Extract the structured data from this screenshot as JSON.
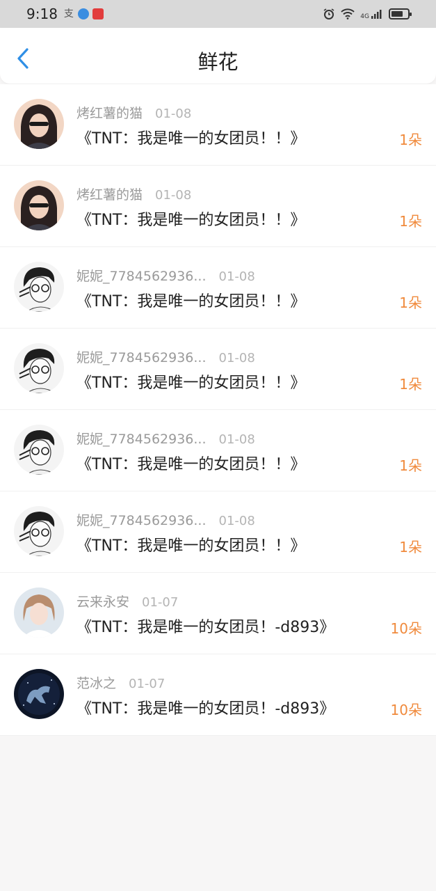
{
  "status": {
    "time": "9:18",
    "app1": "支",
    "network": "4G"
  },
  "header": {
    "title": "鲜花"
  },
  "items": [
    {
      "user": "烤红薯的猫",
      "date": "01-08",
      "book": "《TNT：我是唯一的女团员！！》",
      "count": "1朵",
      "avatar": "avatar-a"
    },
    {
      "user": "烤红薯的猫",
      "date": "01-08",
      "book": "《TNT：我是唯一的女团员！！》",
      "count": "1朵",
      "avatar": "avatar-a"
    },
    {
      "user": "妮妮_7784562936...",
      "date": "01-08",
      "book": "《TNT：我是唯一的女团员！！》",
      "count": "1朵",
      "avatar": "avatar-b"
    },
    {
      "user": "妮妮_7784562936...",
      "date": "01-08",
      "book": "《TNT：我是唯一的女团员！！》",
      "count": "1朵",
      "avatar": "avatar-b"
    },
    {
      "user": "妮妮_7784562936...",
      "date": "01-08",
      "book": "《TNT：我是唯一的女团员！！》",
      "count": "1朵",
      "avatar": "avatar-b"
    },
    {
      "user": "妮妮_7784562936...",
      "date": "01-08",
      "book": "《TNT：我是唯一的女团员！！》",
      "count": "1朵",
      "avatar": "avatar-b"
    },
    {
      "user": "云来永安",
      "date": "01-07",
      "book": "《TNT：我是唯一的女团员！-d893》",
      "count": "10朵",
      "avatar": "avatar-c"
    },
    {
      "user": "范冰之",
      "date": "01-07",
      "book": "《TNT：我是唯一的女团员！-d893》",
      "count": "10朵",
      "avatar": "avatar-d"
    }
  ],
  "colors": {
    "accent": "#f08a3c",
    "back": "#2f8fe6"
  }
}
